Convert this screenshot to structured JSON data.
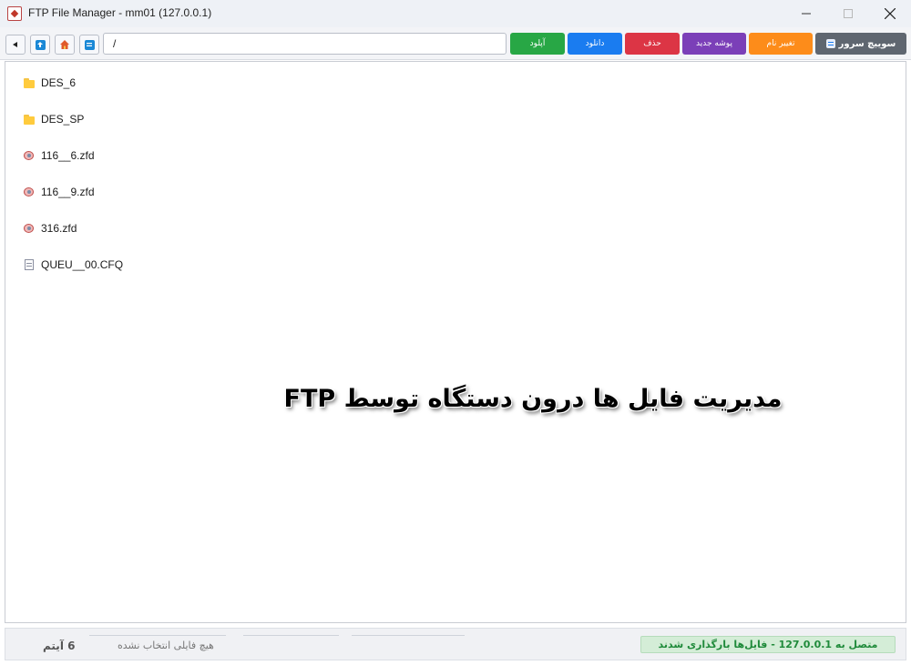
{
  "window": {
    "title": "FTP File Manager - mm01 (127.0.0.1)",
    "controls": {
      "minimize": "—",
      "maximize": "☐",
      "close": "✕"
    }
  },
  "toolbar": {
    "nav": [
      {
        "icon": "back-arrow-icon",
        "glyph": "◂"
      },
      {
        "icon": "up-folder-icon",
        "glyph": "⬆",
        "color": "#1a88d6"
      },
      {
        "icon": "home-icon",
        "glyph": "⌂",
        "color": "#e05a2b"
      },
      {
        "icon": "refresh-icon",
        "glyph": "⟳",
        "color": "#1a88d6"
      }
    ],
    "path": "/",
    "buttons": {
      "upload": {
        "label": "آپلود",
        "color": "#28a745"
      },
      "download": {
        "label": "دانلود",
        "color": "#1a7cf0"
      },
      "delete": {
        "label": "حذف",
        "color": "#dc3545"
      },
      "new_folder": {
        "label": "پوشه جدید",
        "color": "#7b3fb8"
      },
      "rename": {
        "label": "تغییر نام",
        "color": "#fd8c1a"
      },
      "switch_server": {
        "label": "سوییچ سرور",
        "color": "#5f6670"
      }
    }
  },
  "files": [
    {
      "name": "DES_6",
      "type": "folder"
    },
    {
      "name": "DES_SP",
      "type": "folder"
    },
    {
      "name": "116__6.zfd",
      "type": "zfd"
    },
    {
      "name": "116__9.zfd",
      "type": "zfd"
    },
    {
      "name": "316.zfd",
      "type": "zfd"
    },
    {
      "name": "QUEU__00.CFQ",
      "type": "document"
    }
  ],
  "overlay_caption": "مدیریت فایل ها درون دستگاه توسط FTP",
  "status": {
    "count": "6 آیتم",
    "selection": "هیچ فایلی انتخاب نشده",
    "connection": "متصل به 127.0.0.1 - فایل‌ها بارگذاری شدند"
  }
}
